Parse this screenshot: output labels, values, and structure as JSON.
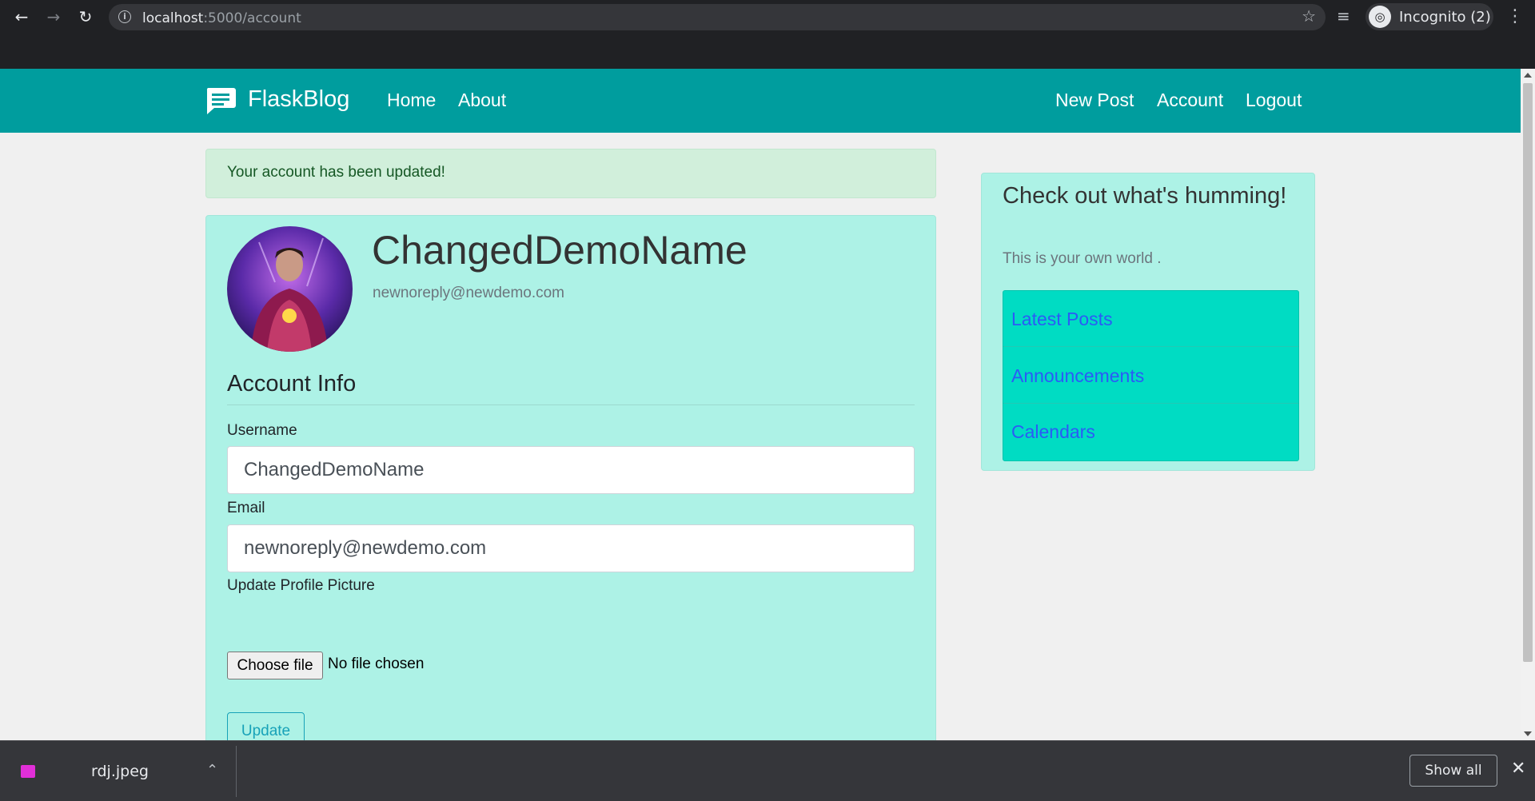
{
  "browser": {
    "url_host": "localhost",
    "url_path": ":5000/account",
    "incognito_label": "Incognito (2)"
  },
  "navbar": {
    "brand": "FlaskBlog",
    "left_links": [
      "Home",
      "About"
    ],
    "right_links": [
      "New Post",
      "Account",
      "Logout"
    ]
  },
  "alert": {
    "message": "Your account has been updated!"
  },
  "profile": {
    "username": "ChangedDemoName",
    "email": "newnoreply@newdemo.com"
  },
  "form": {
    "legend": "Account Info",
    "username_label": "Username",
    "username_value": "ChangedDemoName",
    "email_label": "Email",
    "email_value": "newnoreply@newdemo.com",
    "picture_label": "Update Profile Picture",
    "file_button": "Choose file",
    "file_status": "No file chosen",
    "submit_label": "Update"
  },
  "sidebar": {
    "title": "Check out what's humming!",
    "text": "This is your own world .",
    "links": [
      "Latest Posts",
      "Announcements",
      "Calendars"
    ]
  },
  "downloads": {
    "file_name": "rdj.jpeg",
    "show_all": "Show all"
  },
  "colors": {
    "navbar": "#009d9e",
    "card": "#adf2e6",
    "sidebar_list": "#00dcc3",
    "alert_bg": "#d1efdb",
    "link": "#2b5bf6",
    "update_button": "#17a2b8"
  }
}
